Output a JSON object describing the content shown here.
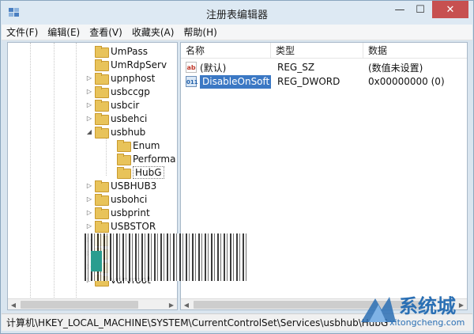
{
  "window": {
    "title": "注册表编辑器",
    "minimize": "—",
    "maximize": "☐",
    "close": "✕"
  },
  "menu": [
    "文件(F)",
    "编辑(E)",
    "查看(V)",
    "收藏夹(A)",
    "帮助(H)"
  ],
  "tree": {
    "items": [
      {
        "label": "UmPass",
        "level": 0,
        "expander": ""
      },
      {
        "label": "UmRdpServ",
        "level": 0,
        "expander": ""
      },
      {
        "label": "upnphost",
        "level": 0,
        "expander": "▷"
      },
      {
        "label": "usbccgp",
        "level": 0,
        "expander": "▷"
      },
      {
        "label": "usbcir",
        "level": 0,
        "expander": "▷"
      },
      {
        "label": "usbehci",
        "level": 0,
        "expander": "▷"
      },
      {
        "label": "usbhub",
        "level": 0,
        "expander": "◢"
      },
      {
        "label": "Enum",
        "level": 1,
        "expander": ""
      },
      {
        "label": "Performa",
        "level": 1,
        "expander": ""
      },
      {
        "label": "HubG",
        "level": 1,
        "expander": "",
        "selected": true
      },
      {
        "label": "USBHUB3",
        "level": 0,
        "expander": "▷"
      },
      {
        "label": "usbohci",
        "level": 0,
        "expander": "▷"
      },
      {
        "label": "usbprint",
        "level": 0,
        "expander": "▷"
      },
      {
        "label": "USBSTOR",
        "level": 0,
        "expander": "▷"
      },
      {
        "label": "",
        "level": 0,
        "expander": "▷"
      },
      {
        "label": "",
        "level": 0,
        "expander": "▷"
      },
      {
        "label": "",
        "level": 0,
        "expander": "▷"
      },
      {
        "label": "vdrvroot",
        "level": 0,
        "expander": "▷"
      }
    ]
  },
  "list": {
    "columns": [
      "名称",
      "类型",
      "数据"
    ],
    "rows": [
      {
        "icon": "ab",
        "name": "(默认)",
        "type": "REG_SZ",
        "data": "(数值未设置)"
      },
      {
        "icon": "binary",
        "name": "DisableOnSoft...",
        "type": "REG_DWORD",
        "data": "0x00000000 (0)",
        "editing": true
      }
    ]
  },
  "status": {
    "path": "计算机\\HKEY_LOCAL_MACHINE\\SYSTEM\\CurrentControlSet\\Services\\usbhub\\HubG"
  },
  "watermark": {
    "cn": "系统城",
    "url": "xitongcheng.com"
  },
  "scroll": {
    "tree_thumb": 0.82,
    "list_thumb": 0.88
  }
}
